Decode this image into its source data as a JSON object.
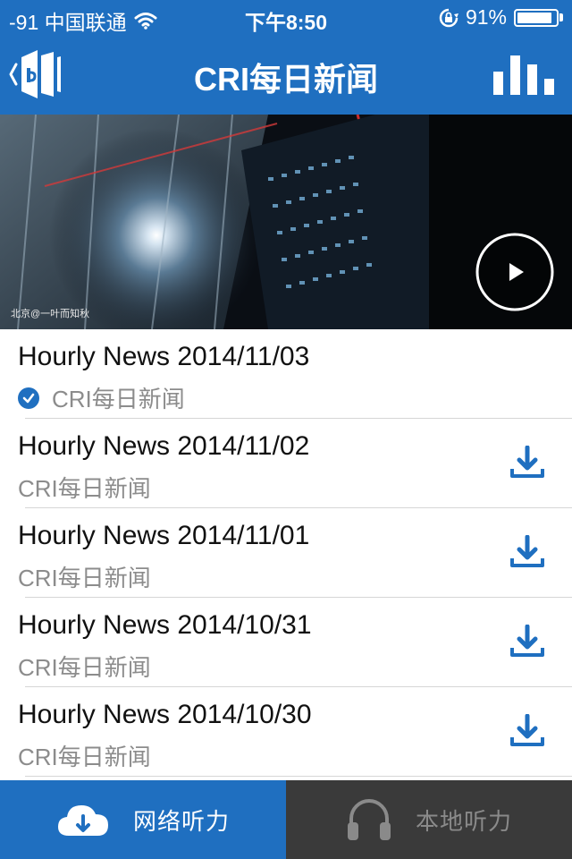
{
  "status_bar": {
    "carrier": "-91 中国联通",
    "time": "下午8:50",
    "battery_percent": "91%",
    "battery_level": 0.91,
    "icons": [
      "wifi-icon",
      "rotation-lock-icon",
      "battery-icon"
    ]
  },
  "nav": {
    "title": "CRI每日新闻",
    "back_icon": "back-logo-icon",
    "right_icon": "bar-chart-icon"
  },
  "hero": {
    "caption": "北京@一叶而知秋",
    "play_icon": "play-icon"
  },
  "episodes": [
    {
      "title": "Hourly News 2014/11/03",
      "source": "CRI每日新闻",
      "downloaded": true
    },
    {
      "title": "Hourly News 2014/11/02",
      "source": "CRI每日新闻",
      "downloaded": false
    },
    {
      "title": "Hourly News 2014/11/01",
      "source": "CRI每日新闻",
      "downloaded": false
    },
    {
      "title": "Hourly News 2014/10/31",
      "source": "CRI每日新闻",
      "downloaded": false
    },
    {
      "title": "Hourly News 2014/10/30",
      "source": "CRI每日新闻",
      "downloaded": false
    }
  ],
  "tabs": [
    {
      "label": "网络听力",
      "icon": "cloud-download-icon",
      "active": true
    },
    {
      "label": "本地听力",
      "icon": "headphones-icon",
      "active": false
    }
  ],
  "colors": {
    "brand_blue": "#1f6fc0",
    "tab_inactive_bg": "#3a3a3a",
    "subtitle_gray": "#8c8c8c"
  }
}
